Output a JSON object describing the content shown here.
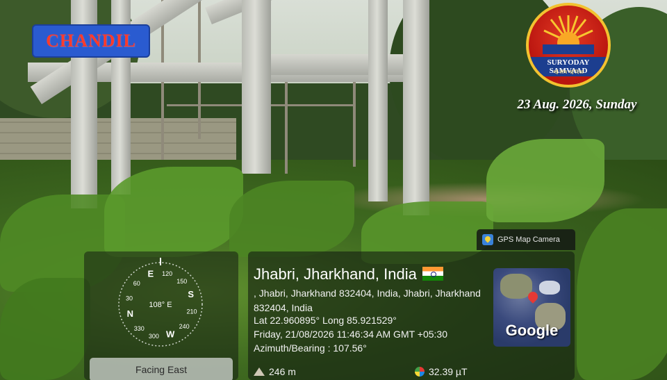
{
  "overlay": {
    "location_tag": "CHANDIL",
    "brand": {
      "name": "SURYODAY SAMVAAD",
      "tagline": "नई सोच नई दिशा"
    },
    "date_line": "23 Aug. 2026, Sunday"
  },
  "compass": {
    "labels": [
      "N",
      "30",
      "60",
      "E",
      "120",
      "150",
      "S",
      "210",
      "240",
      "W",
      "300",
      "330"
    ],
    "center_reading": "108° E",
    "facing": "Facing East"
  },
  "gps_card": {
    "badge": "GPS Map Camera",
    "title": "Jhabri, Jharkhand, India",
    "address": ", Jhabri, Jharkhand 832404, India, Jhabri, Jharkhand 832404, India",
    "lat_long": "Lat 22.960895° Long 85.921529°",
    "datetime": "Friday, 21/08/2026 11:46:34 AM GMT +05:30",
    "azimuth": "Azimuth/Bearing : 107.56°",
    "altitude": "246 m",
    "magnetic_field": "32.39 µT",
    "map_label": "Google"
  },
  "icons": [
    "compass-icon",
    "gps-camera-icon",
    "india-flag-icon",
    "altitude-icon",
    "magnetic-field-icon",
    "map-pin-icon"
  ],
  "colors": {
    "tag_bg": "#2a5bd0",
    "tag_text": "#ff3b2b",
    "logo_red": "#b9150f",
    "logo_gold": "#f2c230"
  }
}
